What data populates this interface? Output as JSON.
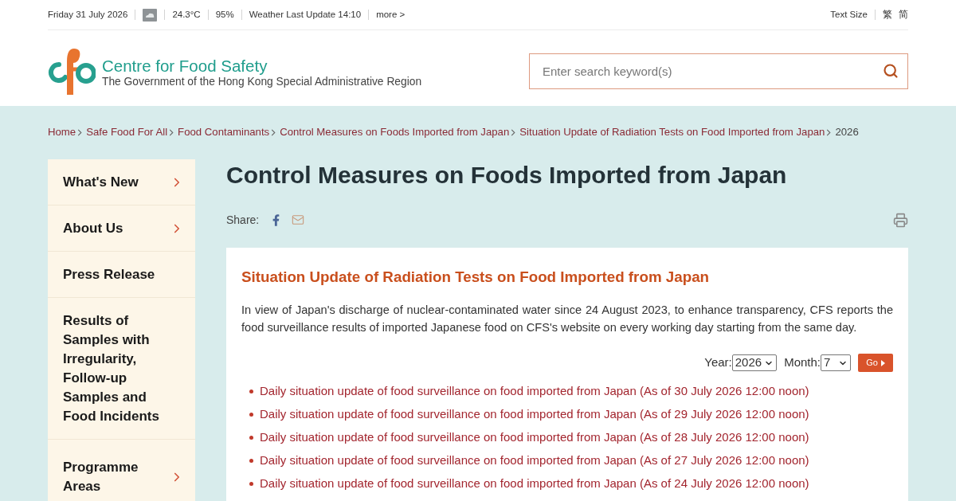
{
  "top_bar": {
    "date": "Friday 31 July 2026",
    "temperature": "24.3°C",
    "humidity": "95%",
    "weather_update": "Weather Last Update 14:10",
    "more_link": "more >",
    "text_size": "Text Size",
    "languages": [
      "繁",
      "简"
    ]
  },
  "header": {
    "title": "Centre for Food Safety",
    "subtitle": "The Government of the Hong Kong Special Administrative Region",
    "search": {
      "placeholder": "Enter search keyword(s)"
    }
  },
  "breadcrumb": [
    {
      "label": "Home",
      "current": false
    },
    {
      "label": "Safe Food For All",
      "current": false
    },
    {
      "label": "Food Contaminants",
      "current": false
    },
    {
      "label": "Control Measures on Foods Imported from Japan",
      "current": false
    },
    {
      "label": "Situation Update of Radiation Tests on Food Imported from Japan",
      "current": false
    },
    {
      "label": "2026",
      "current": true
    }
  ],
  "sidebar": {
    "items": [
      {
        "label": "What's New",
        "has_submenu": true
      },
      {
        "label": "About Us",
        "has_submenu": true
      },
      {
        "label": "Press Release",
        "has_submenu": false
      },
      {
        "label": "Results of Samples with Irregularity, Follow-up Samples and Food Incidents",
        "has_submenu": false
      },
      {
        "label": "Programme Areas",
        "has_submenu": true
      }
    ]
  },
  "page": {
    "title": "Control Measures on Foods Imported from Japan",
    "share_label": "Share:"
  },
  "section": {
    "heading": "Situation Update of Radiation Tests on Food Imported from Japan",
    "intro": "In view of Japan's discharge of nuclear-contaminated water since 24 August 2023, to enhance transparency, CFS reports the food surveillance results of imported Japanese food on CFS's website on every working day starting from the same day.",
    "filter": {
      "year_label": "Year:",
      "year": "2026",
      "month_label": "Month:",
      "month": "7",
      "button": "Go"
    },
    "updates": [
      "Daily situation update of food surveillance on food imported from Japan (As of 30 July 2026 12:00 noon)",
      "Daily situation update of food surveillance on food imported from Japan (As of 29 July 2026 12:00 noon)",
      "Daily situation update of food surveillance on food imported from Japan (As of 28 July 2026 12:00 noon)",
      "Daily situation update of food surveillance on food imported from Japan (As of 27 July 2026 12:00 noon)",
      "Daily situation update of food surveillance on food imported from Japan (As of 24 July 2026 12:00 noon)"
    ]
  }
}
